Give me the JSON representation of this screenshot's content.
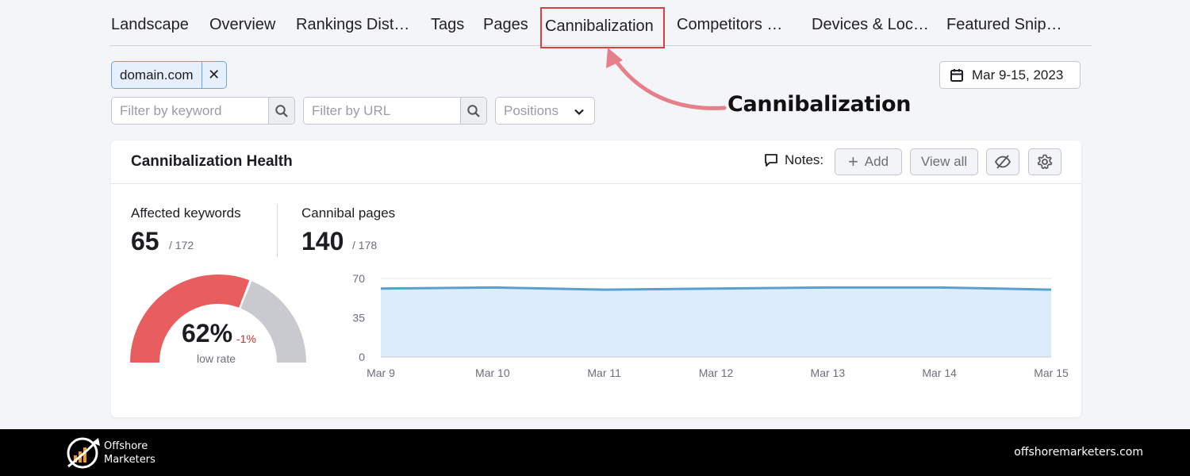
{
  "tabs": [
    {
      "label": "Landscape"
    },
    {
      "label": "Overview"
    },
    {
      "label": "Rankings Dist…"
    },
    {
      "label": "Tags"
    },
    {
      "label": "Pages"
    },
    {
      "label": "Cannibalization",
      "active": true
    },
    {
      "label": "Competitors …"
    },
    {
      "label": "Devices & Loc…"
    },
    {
      "label": "Featured Snip…"
    }
  ],
  "filters": {
    "domain_chip": "domain.com",
    "chip_remove_icon": "close-icon",
    "keyword_placeholder": "Filter by keyword",
    "url_placeholder": "Filter by URL",
    "positions_label": "Positions",
    "date_range": "Mar 9-15, 2023"
  },
  "annotation": {
    "label": "Cannibalization",
    "arrow_color": "#e57f8a"
  },
  "card": {
    "title": "Cannibalization Health",
    "notes_label": "Notes:",
    "add_label": "Add",
    "view_all_label": "View all",
    "affected_keywords": {
      "label": "Affected keywords",
      "value": "65",
      "total": "/ 172"
    },
    "cannibal_pages": {
      "label": "Cannibal pages",
      "value": "140",
      "total": "/ 178"
    },
    "gauge": {
      "percent_text": "62%",
      "percent": 62,
      "delta": "-1%",
      "sublabel": "low rate",
      "fill_color": "#e85d5d",
      "rest_color": "#c9cad0"
    }
  },
  "chart_data": {
    "type": "area",
    "x": [
      "Mar 9",
      "Mar 10",
      "Mar 11",
      "Mar 12",
      "Mar 13",
      "Mar 14",
      "Mar 15"
    ],
    "series": [
      {
        "values": [
          61,
          62,
          60,
          61,
          62,
          62,
          60
        ]
      }
    ],
    "y_ticks": [
      "70",
      "35",
      "0"
    ],
    "ylim": [
      0,
      70
    ],
    "line_color": "#5aa0cf",
    "fill_color": "#dcecfb",
    "grid": true
  },
  "footer": {
    "brand_line1": "Offshore",
    "brand_line2": "Marketers",
    "url": "offshoremarketers.com"
  }
}
